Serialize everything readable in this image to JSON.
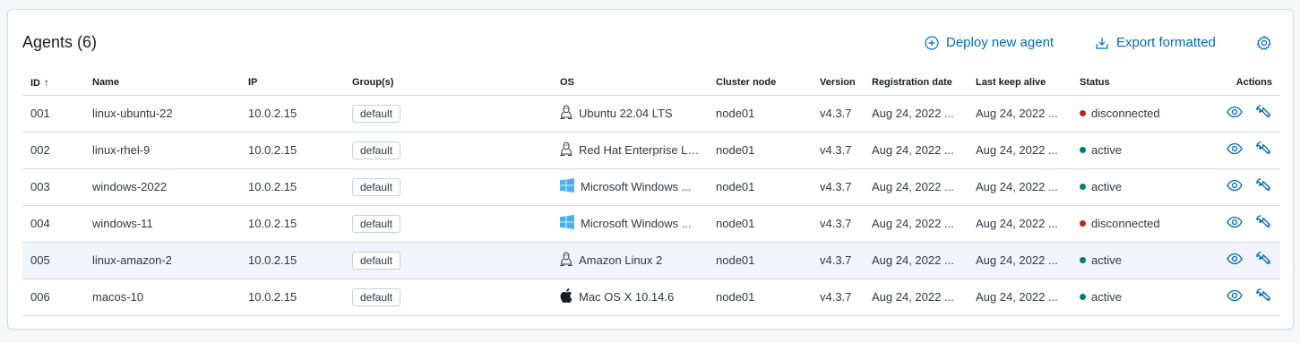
{
  "header": {
    "title": "Agents (6)",
    "deploy_label": "Deploy new agent",
    "export_label": "Export formatted"
  },
  "colors": {
    "accent": "#006bb8",
    "active": "#017d73",
    "disconnected": "#bd271e"
  },
  "table": {
    "columns": [
      "ID",
      "Name",
      "IP",
      "Group(s)",
      "OS",
      "Cluster node",
      "Version",
      "Registration date",
      "Last keep alive",
      "Status",
      "Actions"
    ],
    "sort_indicator": "↑",
    "rows": [
      {
        "id": "001",
        "name": "linux-ubuntu-22",
        "ip": "10.0.2.15",
        "group": "default",
        "os_icon": "linux-tux-icon",
        "os": "Ubuntu 22.04 LTS",
        "node": "node01",
        "version": "v4.3.7",
        "reg": "Aug 24, 2022 ...",
        "keep": "Aug 24, 2022 ...",
        "status": "disconnected"
      },
      {
        "id": "002",
        "name": "linux-rhel-9",
        "ip": "10.0.2.15",
        "group": "default",
        "os_icon": "linux-tux-icon",
        "os": "Red Hat Enterprise Li...",
        "node": "node01",
        "version": "v4.3.7",
        "reg": "Aug 24, 2022 ...",
        "keep": "Aug 24, 2022 ...",
        "status": "active"
      },
      {
        "id": "003",
        "name": "windows-2022",
        "ip": "10.0.2.15",
        "group": "default",
        "os_icon": "windows-icon",
        "os": "Microsoft Windows ...",
        "node": "node01",
        "version": "v4.3.7",
        "reg": "Aug 24, 2022 ...",
        "keep": "Aug 24, 2022 ...",
        "status": "active"
      },
      {
        "id": "004",
        "name": "windows-11",
        "ip": "10.0.2.15",
        "group": "default",
        "os_icon": "windows-icon",
        "os": "Microsoft Windows ...",
        "node": "node01",
        "version": "v4.3.7",
        "reg": "Aug 24, 2022 ...",
        "keep": "Aug 24, 2022 ...",
        "status": "disconnected"
      },
      {
        "id": "005",
        "name": "linux-amazon-2",
        "ip": "10.0.2.15",
        "group": "default",
        "os_icon": "linux-tux-icon",
        "os": "Amazon Linux 2",
        "node": "node01",
        "version": "v4.3.7",
        "reg": "Aug 24, 2022 ...",
        "keep": "Aug 24, 2022 ...",
        "status": "active"
      },
      {
        "id": "006",
        "name": "macos-10",
        "ip": "10.0.2.15",
        "group": "default",
        "os_icon": "apple-icon",
        "os": "Mac OS X 10.14.6",
        "node": "node01",
        "version": "v4.3.7",
        "reg": "Aug 24, 2022 ...",
        "keep": "Aug 24, 2022 ...",
        "status": "active"
      }
    ]
  }
}
